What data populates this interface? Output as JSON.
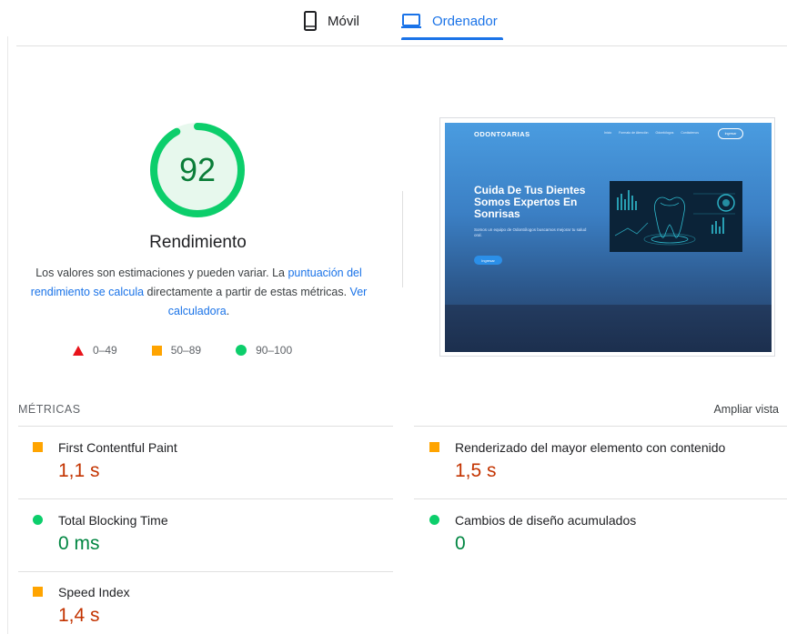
{
  "tabs": {
    "mobile_label": "Móvil",
    "desktop_label": "Ordenador",
    "active": "Ordenador"
  },
  "performance": {
    "score": "92",
    "score_fraction": 0.92,
    "title": "Rendimiento",
    "desc_part1": "Los valores son estimaciones y pueden variar. La ",
    "desc_link1": "puntuación del rendimiento se calcula",
    "desc_part2": " directamente a partir de estas métricas. ",
    "desc_link2": "Ver calculadora",
    "desc_part3": ".",
    "legend": [
      {
        "shape": "triangle",
        "color": "#e8141b",
        "range": "0–49"
      },
      {
        "shape": "square",
        "color": "#ffa400",
        "range": "50–89"
      },
      {
        "shape": "circle",
        "color": "#0cce6b",
        "range": "90–100"
      }
    ]
  },
  "screenshot": {
    "logo": "ODONTOARIAS",
    "nav": [
      "Inicio",
      "Formato de Atención",
      "Odontólogos",
      "Contáctenos"
    ],
    "button": "Ingresar",
    "hero_title": "Cuida De Tus Dientes Somos Expertos En Sonrisas",
    "hero_sub": "Somos un equipo de Odontólogos buscamos mejorar tu salud oral.",
    "hero_button": "Ingresar"
  },
  "metrics": {
    "label": "MÉTRICAS",
    "expand": "Ampliar vista",
    "items": [
      {
        "name": "First Contentful Paint",
        "value": "1,1 s",
        "status": "average"
      },
      {
        "name": "Renderizado del mayor elemento con contenido",
        "value": "1,5 s",
        "status": "average"
      },
      {
        "name": "Total Blocking Time",
        "value": "0 ms",
        "status": "pass"
      },
      {
        "name": "Cambios de diseño acumulados",
        "value": "0",
        "status": "pass"
      },
      {
        "name": "Speed Index",
        "value": "1,4 s",
        "status": "average"
      }
    ]
  },
  "colors": {
    "accent": "#1a73e8",
    "pass": "#0cce6b",
    "average": "#ffa400",
    "fail": "#e8141b"
  }
}
